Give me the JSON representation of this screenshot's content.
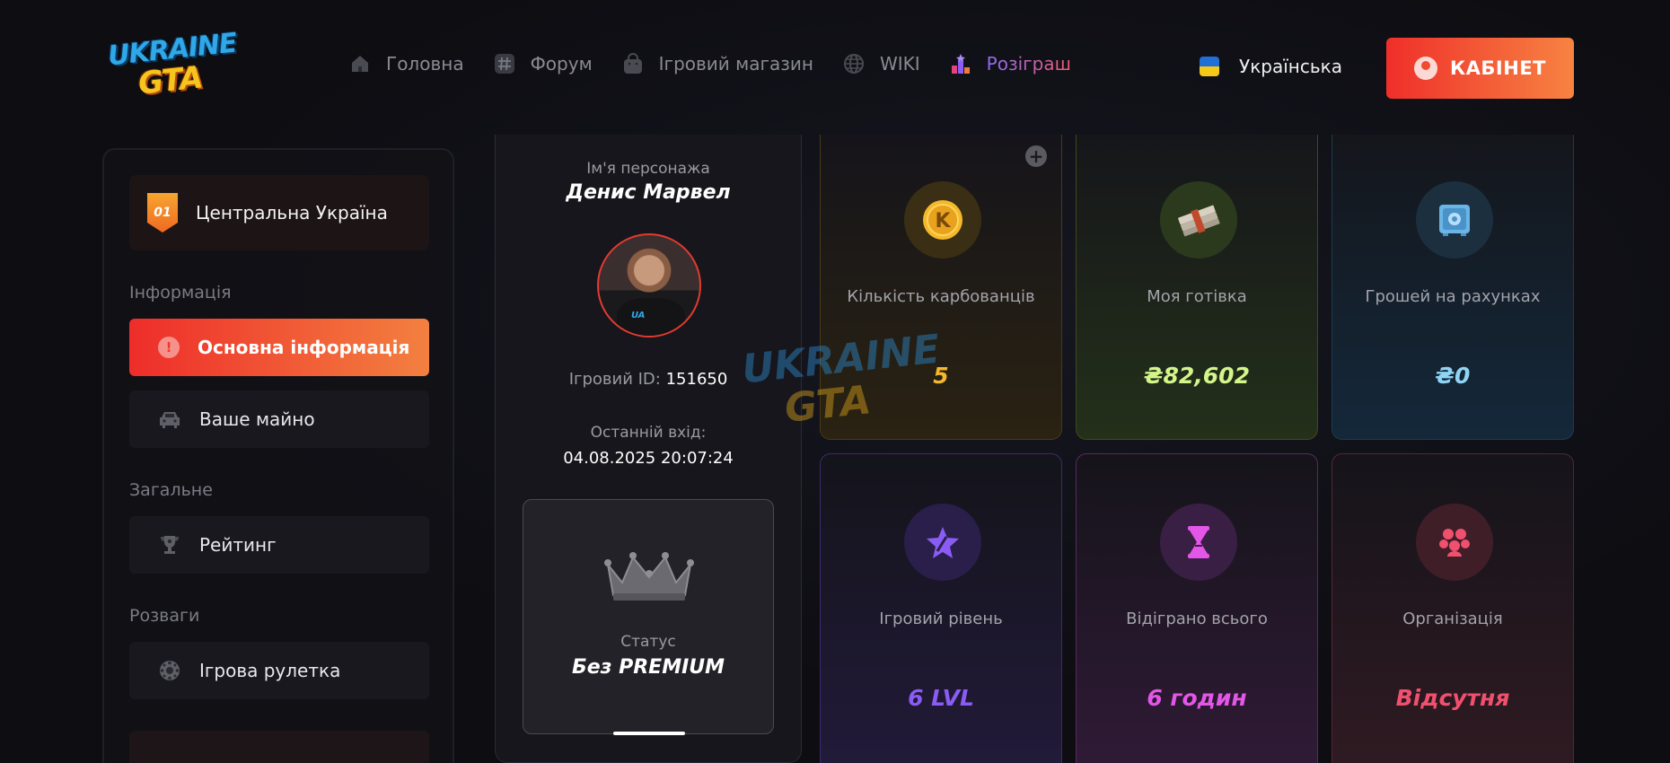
{
  "logo": {
    "line1": "UKRAINE",
    "line2": "GTA"
  },
  "nav": [
    {
      "label": "Головна",
      "icon": "home-icon"
    },
    {
      "label": "Форум",
      "icon": "hash-icon"
    },
    {
      "label": "Ігровий магазин",
      "icon": "shopping-bag-icon"
    },
    {
      "label": "WIKI",
      "icon": "globe-icon"
    },
    {
      "label": "Розіграш",
      "icon": "podium-icon",
      "active": true
    }
  ],
  "language": {
    "label": "Українська"
  },
  "cabinet": {
    "label": "КАБІНЕТ"
  },
  "sidebar": {
    "server": {
      "badge": "01",
      "name": "Центральна Україна"
    },
    "sections": [
      {
        "title": "Інформація"
      },
      {
        "title": "Загальне"
      },
      {
        "title": "Розваги"
      }
    ],
    "items": [
      {
        "label": "Основна інформація",
        "icon": "alert-icon",
        "active": true
      },
      {
        "label": "Ваше майно",
        "icon": "car-icon"
      },
      {
        "label": "Рейтинг",
        "icon": "trophy-icon"
      },
      {
        "label": "Ігрова рулетка",
        "icon": "roulette-icon"
      }
    ]
  },
  "character": {
    "name_label": "Ім'я персонажа",
    "name": "Денис Марвел",
    "id_label": "Ігровий ID:",
    "id": "151650",
    "last_login_label": "Останній вхід:",
    "last_login": "04.08.2025 20:07:24",
    "status_label": "Статус",
    "status": "Без PREMIUM"
  },
  "stats": [
    {
      "label": "Кількість карбованців",
      "value": "5",
      "icon": "coin-icon",
      "color": "#f5b82c"
    },
    {
      "label": "Моя готівка",
      "value": "₴82,602",
      "icon": "cash-stack-icon",
      "color": "#d4f58a"
    },
    {
      "label": "Грошей на рахунках",
      "value": "₴0",
      "icon": "safe-icon",
      "color": "#8fd3f5"
    },
    {
      "label": "Ігровий рівень",
      "value": "6 LVL",
      "icon": "star-icon",
      "color": "#8a5cf5"
    },
    {
      "label": "Відіграно всього",
      "value": "6 годин",
      "icon": "hourglass-icon",
      "color": "#e356e8"
    },
    {
      "label": "Організація",
      "value": "Відсутня",
      "icon": "group-icon",
      "color": "#f0506e"
    }
  ],
  "watermark": {
    "line1": "UKRAINE",
    "line2": "GTA"
  }
}
